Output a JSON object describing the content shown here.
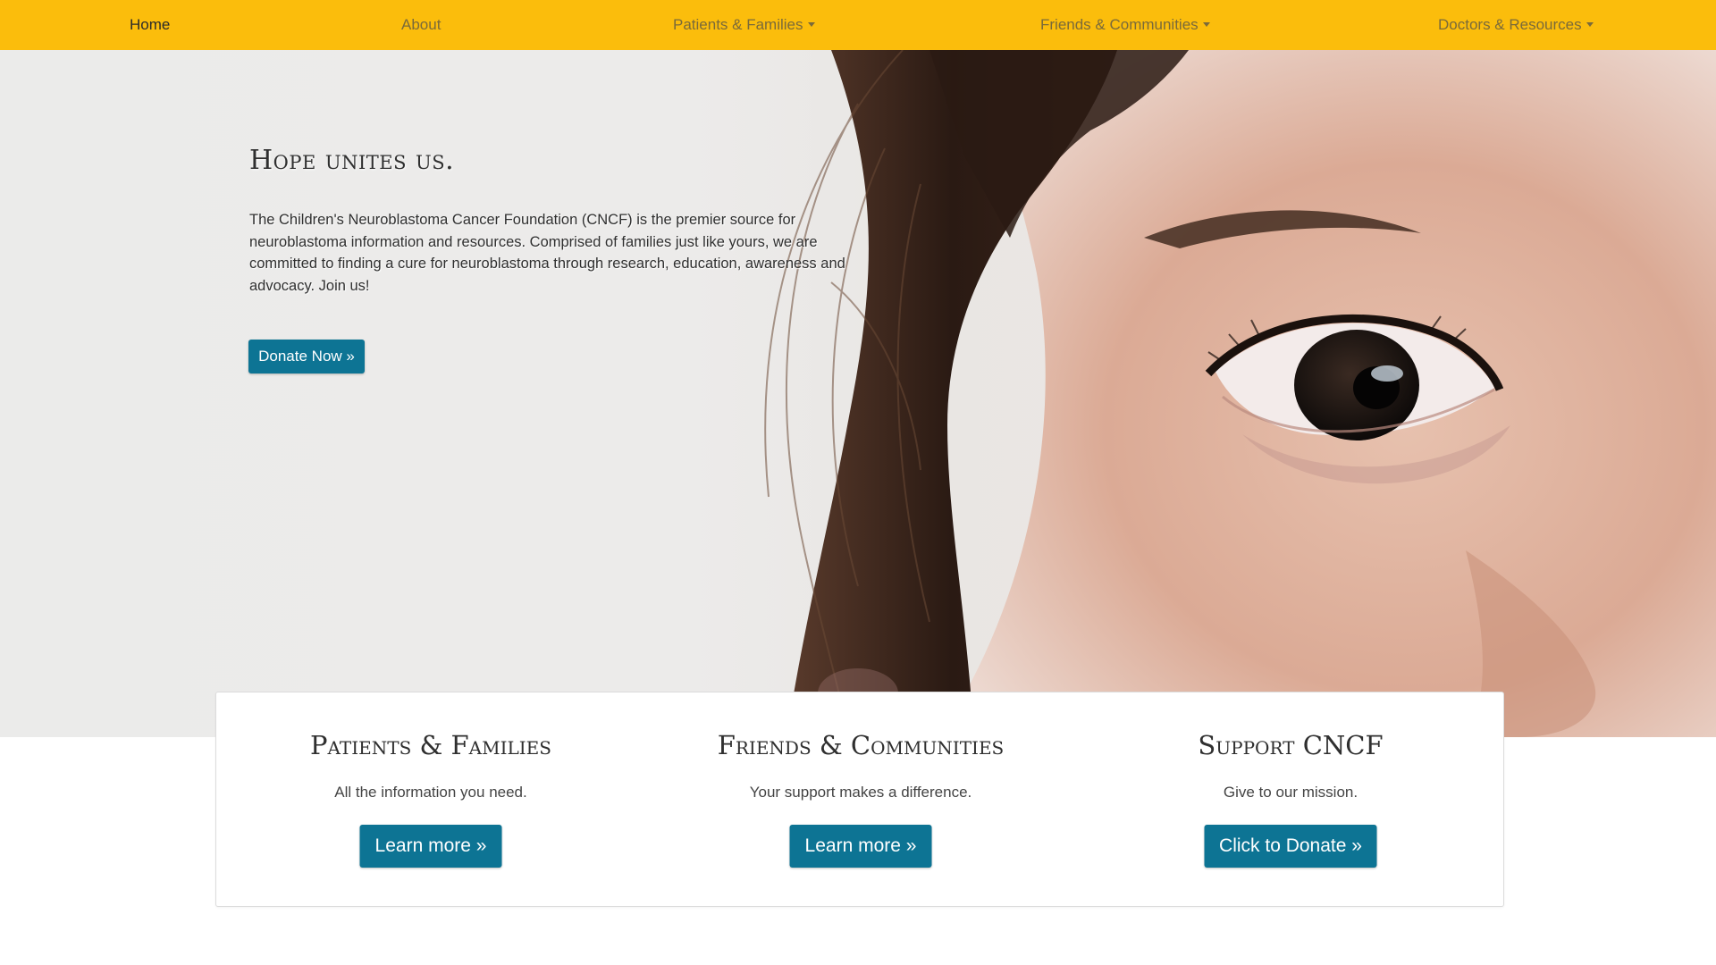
{
  "nav": {
    "items": [
      {
        "label": "Home",
        "active": true,
        "dropdown": false
      },
      {
        "label": "About",
        "active": false,
        "dropdown": false
      },
      {
        "label": "Patients & Families",
        "active": false,
        "dropdown": true
      },
      {
        "label": "Friends & Communities",
        "active": false,
        "dropdown": true
      },
      {
        "label": "Doctors & Resources",
        "active": false,
        "dropdown": true
      }
    ]
  },
  "hero": {
    "title": "Hope unites us.",
    "text": "The Children's Neuroblastoma Cancer Foundation (CNCF) is the premier source for neuroblastoma information and resources. Comprised of families just like yours, we are committed to finding a cure for neuroblastoma through research, education, awareness and advocacy. Join us!",
    "button": "Donate Now »"
  },
  "cards": [
    {
      "title": "Patients & Families",
      "desc": "All the information you need.",
      "button": "Learn more »"
    },
    {
      "title": "Friends & Communities",
      "desc": "Your support makes a difference.",
      "button": "Learn more »"
    },
    {
      "title": "Support CNCF",
      "desc": "Give to our mission.",
      "button": "Click to Donate »"
    }
  ],
  "colors": {
    "navbar": "#fbbd0c",
    "button": "#0d7494",
    "nav_text": "#7a6a3a"
  }
}
